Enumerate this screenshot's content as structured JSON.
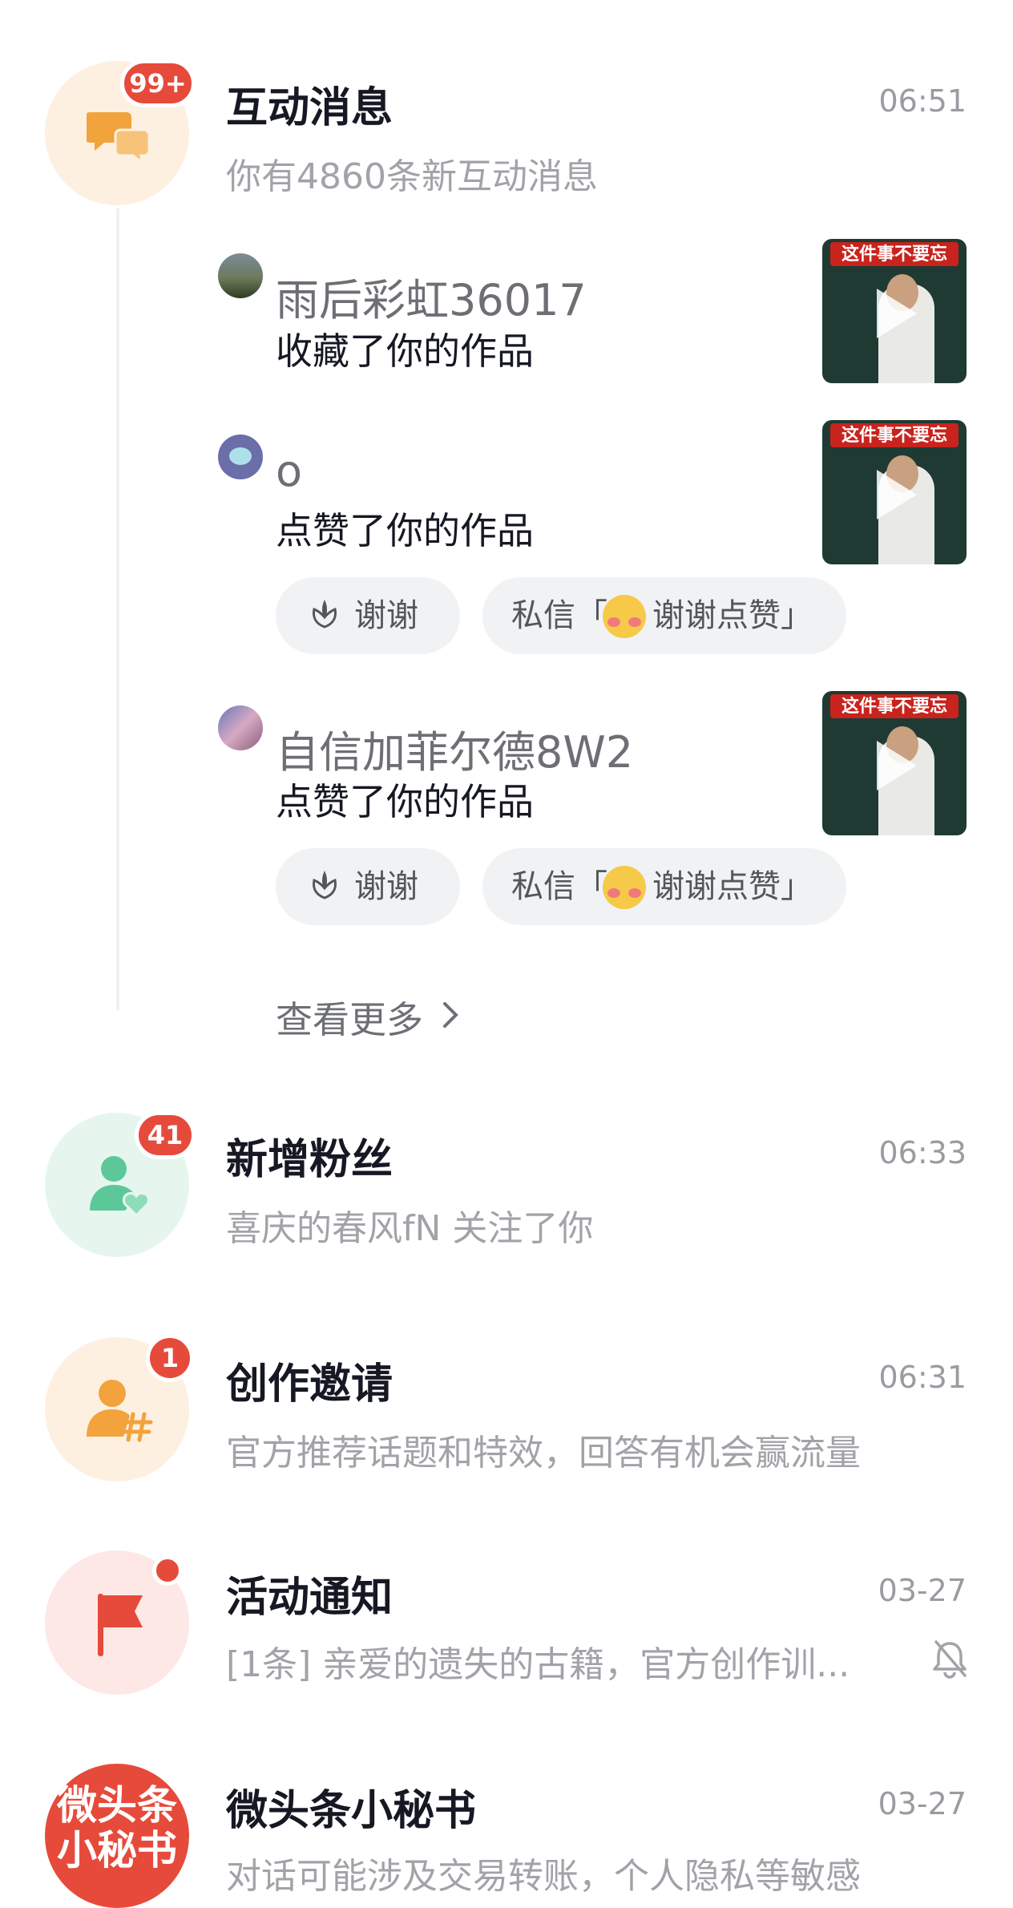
{
  "interaction": {
    "title": "互动消息",
    "badge": "99+",
    "time": "06:51",
    "subtitle": "你有4860条新互动消息",
    "items": [
      {
        "user": "雨后彩虹36017",
        "action": "收藏了你的作品",
        "thumb_banner": "这件事不要忘"
      },
      {
        "user": "o",
        "action": "点赞了你的作品",
        "thumb_banner": "这件事不要忘",
        "thanks": "谢谢",
        "dm_prefix": "私信「",
        "dm_text": "谢谢点赞」"
      },
      {
        "user": "自信加菲尔德8W2",
        "action": "点赞了你的作品",
        "thumb_banner": "这件事不要忘",
        "thanks": "谢谢",
        "dm_prefix": "私信「",
        "dm_text": "谢谢点赞」"
      }
    ],
    "see_more": "查看更多"
  },
  "followers": {
    "title": "新增粉丝",
    "badge": "41",
    "time": "06:33",
    "subtitle": "喜庆的春风fN 关注了你"
  },
  "invite": {
    "title": "创作邀请",
    "badge": "1",
    "time": "06:31",
    "subtitle": "官方推荐话题和特效，回答有机会赢流量"
  },
  "activity": {
    "title": "活动通知",
    "time": "03-27",
    "subtitle": "[1条] 亲爱的遗失的古籍，官方创作训..."
  },
  "secretary": {
    "title": "微头条小秘书",
    "time": "03-27",
    "avatar_text": "微头条小秘书",
    "subtitle": "对话可能涉及交易转账，个人隐私等敏感"
  },
  "colors": {
    "accent_red": "#e64a3b",
    "orange": "#f2a33c",
    "green": "#5cc89a"
  }
}
